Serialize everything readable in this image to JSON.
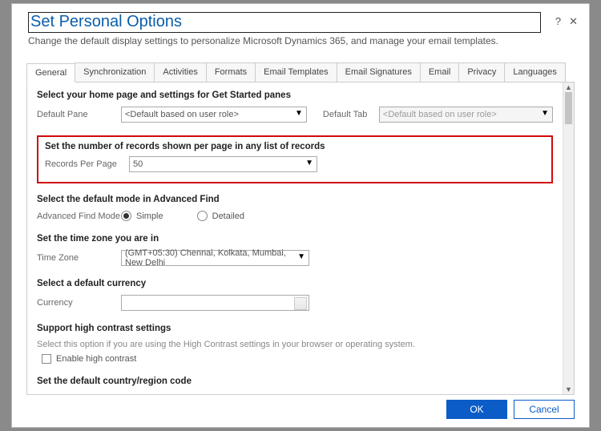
{
  "header": {
    "title": "Set Personal Options",
    "subtitle": "Change the default display settings to personalize Microsoft Dynamics 365, and manage your email templates."
  },
  "tabs": [
    {
      "label": "General",
      "active": true
    },
    {
      "label": "Synchronization"
    },
    {
      "label": "Activities"
    },
    {
      "label": "Formats"
    },
    {
      "label": "Email Templates"
    },
    {
      "label": "Email Signatures"
    },
    {
      "label": "Email"
    },
    {
      "label": "Privacy"
    },
    {
      "label": "Languages"
    }
  ],
  "sections": {
    "homepage": {
      "title": "Select your home page and settings for Get Started panes",
      "defaultPaneLabel": "Default Pane",
      "defaultPaneValue": "<Default based on user role>",
      "defaultTabLabel": "Default Tab",
      "defaultTabValue": "<Default based on user role>"
    },
    "records": {
      "title": "Set the number of records shown per page in any list of records",
      "recordsLabel": "Records Per Page",
      "recordsValue": "50"
    },
    "advFind": {
      "title": "Select the default mode in Advanced Find",
      "modeLabel": "Advanced Find Mode",
      "simple": "Simple",
      "detailed": "Detailed"
    },
    "tz": {
      "title": "Set the time zone you are in",
      "tzLabel": "Time Zone",
      "tzValue": "(GMT+05:30) Chennai, Kolkata, Mumbai, New Delhi"
    },
    "currency": {
      "title": "Select a default currency",
      "currencyLabel": "Currency"
    },
    "contrast": {
      "title": "Support high contrast settings",
      "note": "Select this option if you are using the High Contrast settings in your browser or operating system.",
      "checkLabel": "Enable high contrast"
    },
    "region": {
      "title": "Set the default country/region code"
    }
  },
  "footer": {
    "ok": "OK",
    "cancel": "Cancel"
  },
  "icons": {
    "help": "?",
    "close": "✕",
    "up": "▲",
    "down": "▼"
  }
}
